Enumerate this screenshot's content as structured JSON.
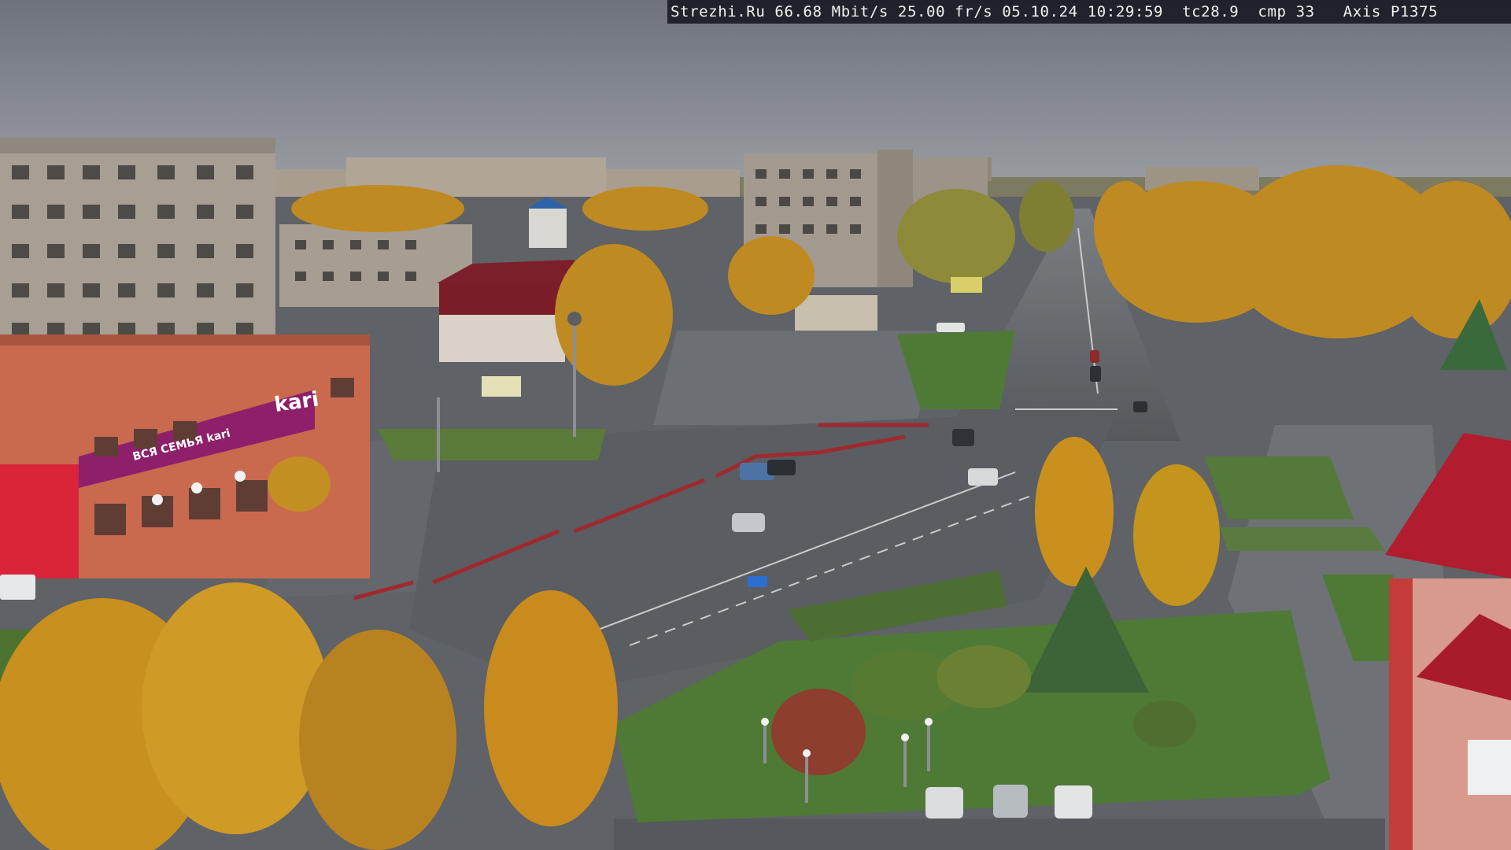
{
  "overlay": {
    "text": "Strezhi.Ru 66.68 Mbit/s 25.00 fr/s 05.10.24 10:29:59  tc28.9  cmp 33   Axis P1375"
  },
  "signs": {
    "store_kari_logo": "kari",
    "store_kari_banner": "ВСЯ СЕМЬЯ kari"
  },
  "colors": {
    "sky": "#7b8088",
    "asphalt": "#5b5e62",
    "foliage": "#c88a1e",
    "lawn": "#4f7a35",
    "store_magenta": "#8e1f6b",
    "roof_red": "#b11d2e"
  }
}
